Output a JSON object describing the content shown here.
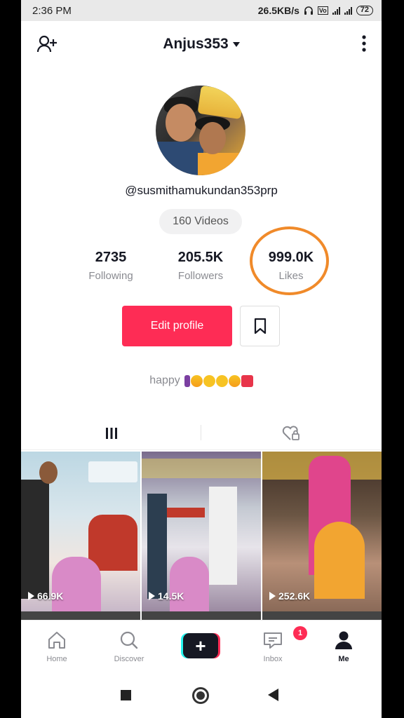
{
  "status_bar": {
    "time": "2:36 PM",
    "network_speed": "26.5KB/s",
    "battery": "72"
  },
  "header": {
    "username": "Anjus353",
    "add_user_icon": "add-user-icon",
    "more_icon": "more-vertical-icon"
  },
  "profile": {
    "handle": "@susmithamukundan353prp",
    "videos_count": "160 Videos",
    "bio": "happy"
  },
  "stats": {
    "following": {
      "value": "2735",
      "label": "Following"
    },
    "followers": {
      "value": "205.5K",
      "label": "Followers"
    },
    "likes": {
      "value": "999.0K",
      "label": "Likes"
    }
  },
  "actions": {
    "edit_profile": "Edit profile",
    "bookmark_icon": "bookmark-icon"
  },
  "tabs": {
    "videos_icon": "grid-icon",
    "liked_icon": "liked-locked-icon"
  },
  "videos": [
    {
      "views": "66.9K"
    },
    {
      "views": "14.5K"
    },
    {
      "views": "252.6K"
    }
  ],
  "nav": {
    "home": "Home",
    "discover": "Discover",
    "inbox": "Inbox",
    "inbox_badge": "1",
    "me": "Me",
    "create": "+"
  },
  "colors": {
    "accent": "#fe2c55",
    "annotation_circle": "#f08a2a",
    "text_primary": "#161823",
    "text_secondary": "#8a8b91"
  }
}
